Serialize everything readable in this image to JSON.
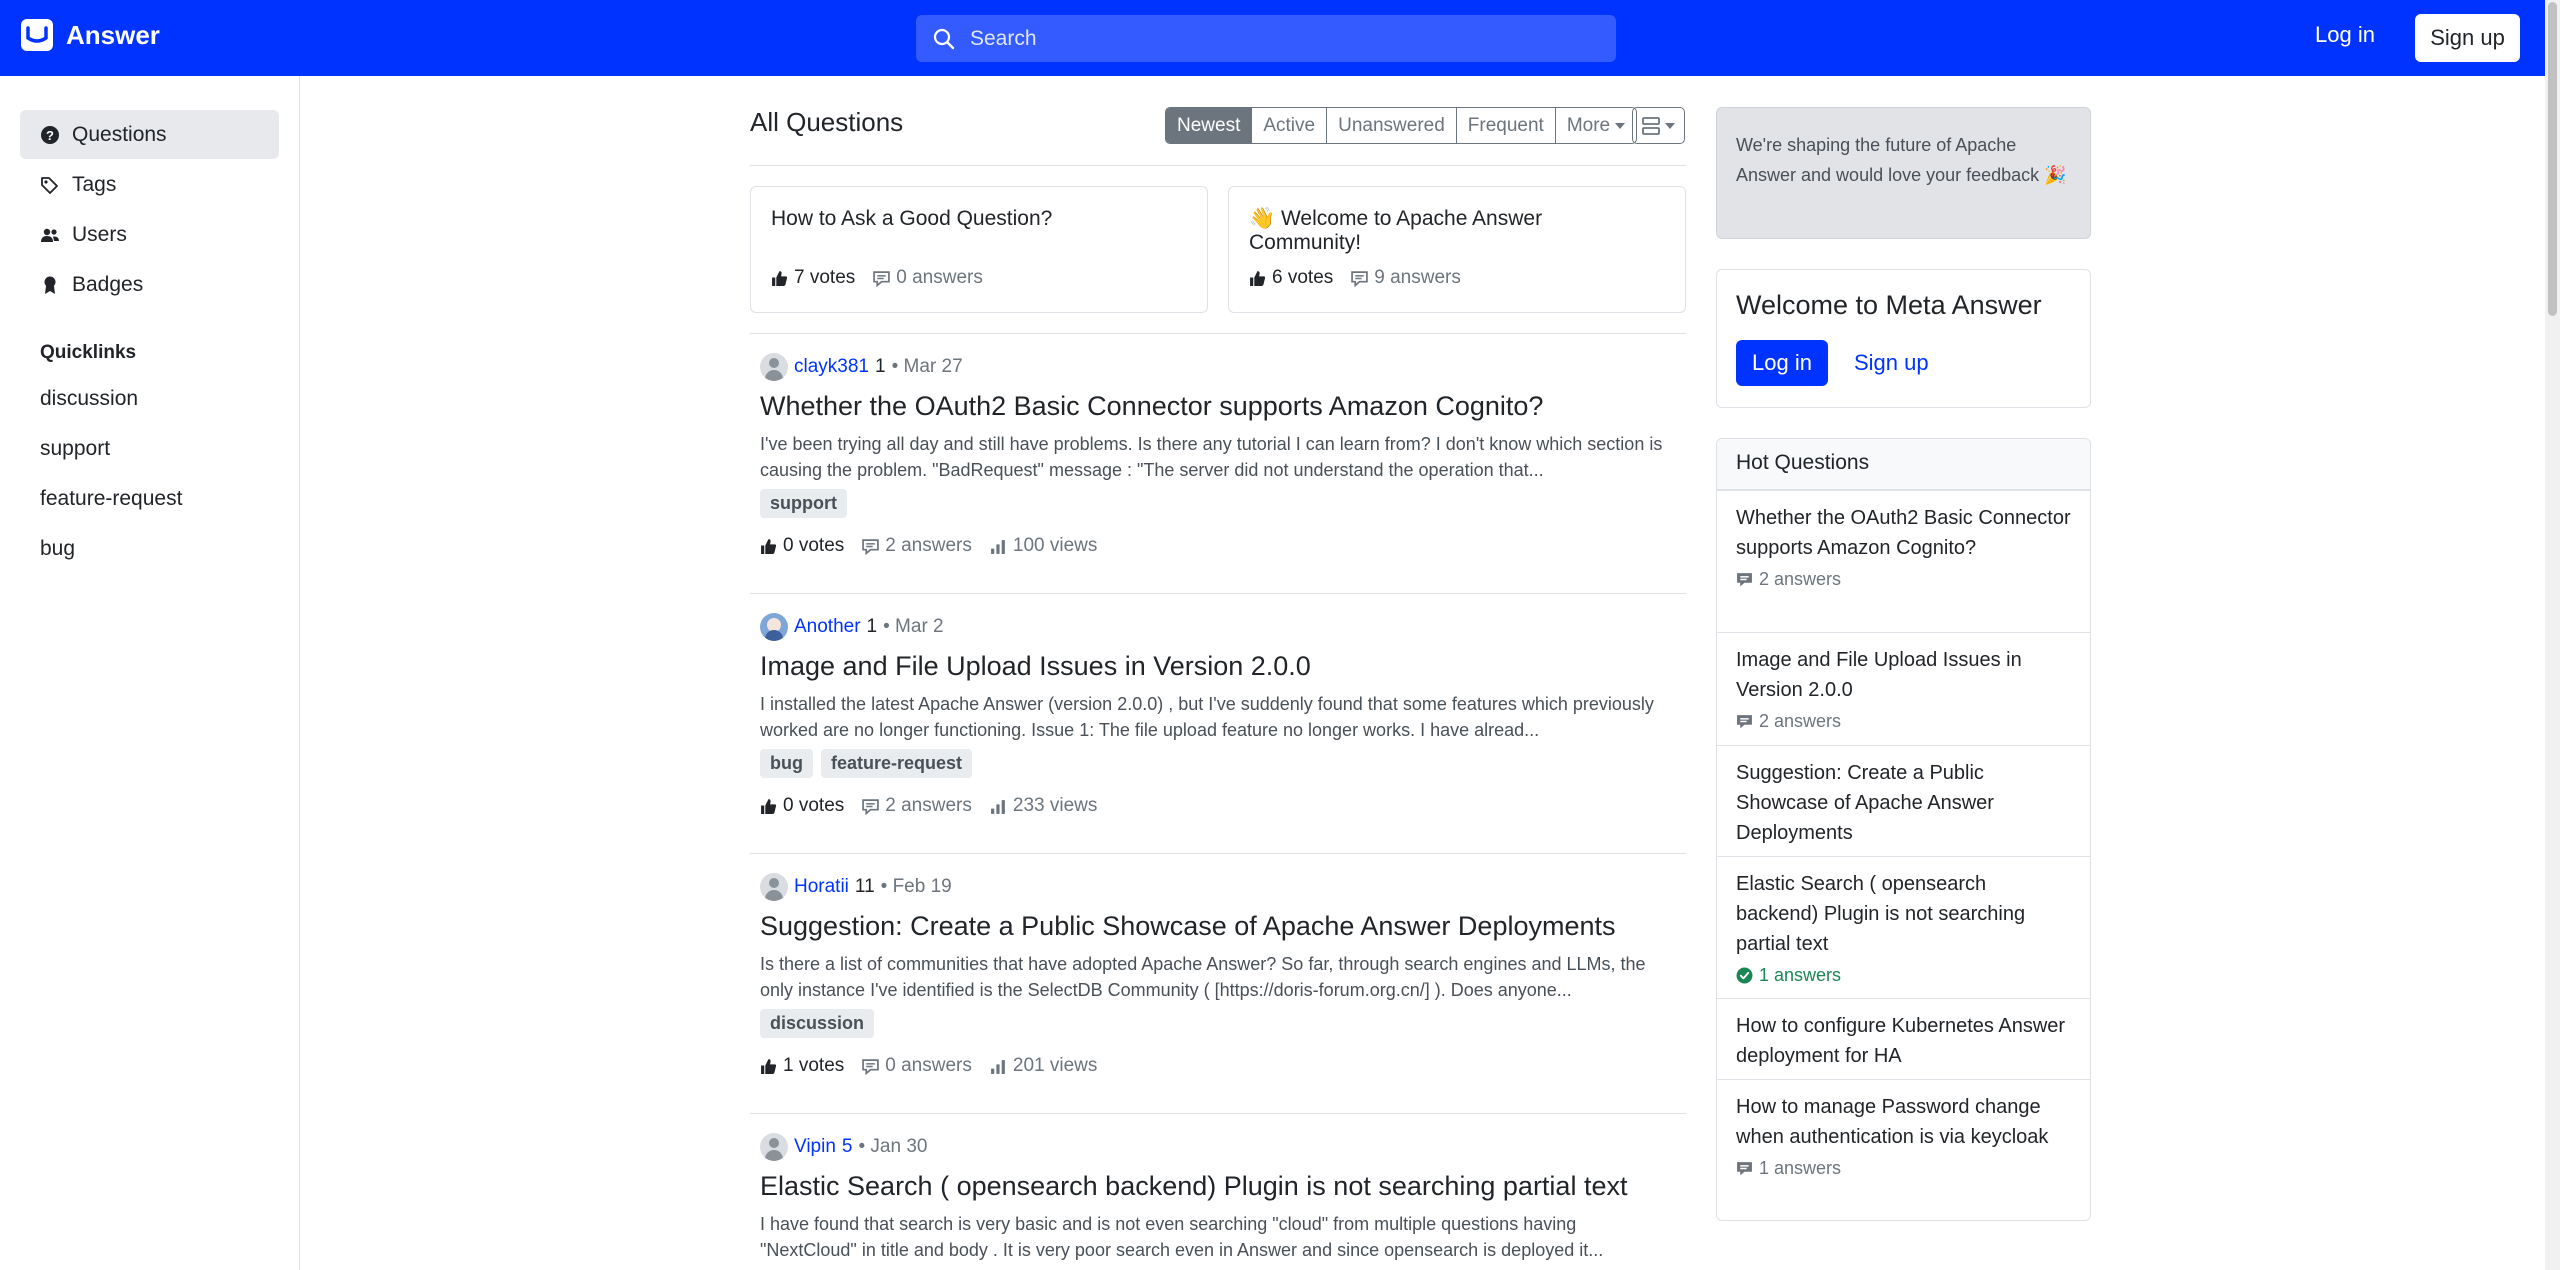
{
  "header": {
    "brand": "Answer",
    "search_placeholder": "Search",
    "login": "Log in",
    "signup": "Sign up"
  },
  "sidebar": {
    "items": [
      {
        "label": "Questions",
        "icon": "question-circle-icon",
        "active": true
      },
      {
        "label": "Tags",
        "icon": "tags-icon"
      },
      {
        "label": "Users",
        "icon": "people-icon"
      },
      {
        "label": "Badges",
        "icon": "award-icon"
      }
    ],
    "quicklinks_title": "Quicklinks",
    "quicklinks": [
      "discussion",
      "support",
      "feature-request",
      "bug"
    ]
  },
  "main": {
    "title": "All Questions",
    "sort_tabs": [
      "Newest",
      "Active",
      "Unanswered",
      "Frequent",
      "More"
    ],
    "active_sort": "Newest",
    "pinned": [
      {
        "title": "How to Ask a Good Question?",
        "votes": "7 votes",
        "answers": "0 answers"
      },
      {
        "title": "👋 Welcome to Apache Answer Community!",
        "votes": "6 votes",
        "answers": "9 answers"
      }
    ],
    "questions": [
      {
        "author": "clayk381",
        "reputation": "1",
        "date": "• Mar 27",
        "title": "Whether the OAuth2 Basic Connector supports Amazon Cognito?",
        "excerpt": "I've been trying all day and still have problems. Is there any tutorial I can learn from? I don't know which section is causing the problem. \"BadRequest\" message : \"The server did not understand the operation that...",
        "tags": [
          "support"
        ],
        "votes": "0 votes",
        "answers": "2 answers",
        "views": "100 views"
      },
      {
        "author": "Another",
        "reputation": "1",
        "date": "• Mar 2",
        "title": "Image and File Upload Issues in Version 2.0.0",
        "excerpt": "I installed the latest Apache Answer (version 2.0.0) , but I've suddenly found that some features which previously worked are no longer functioning. Issue 1: The file upload feature no longer works. I have alread...",
        "tags": [
          "bug",
          "feature-request"
        ],
        "votes": "0 votes",
        "answers": "2 answers",
        "views": "233 views"
      },
      {
        "author": "Horatii",
        "reputation": "11",
        "date": "• Feb 19",
        "title": "Suggestion: Create a Public Showcase of Apache Answer Deployments",
        "excerpt": "Is there a list of communities that have adopted Apache Answer? So far, through search engines and LLMs, the only instance I've identified is the SelectDB Community ( [https://doris-forum.org.cn/] ). Does anyone...",
        "tags": [
          "discussion"
        ],
        "votes": "1 votes",
        "answers": "0 answers",
        "views": "201 views"
      },
      {
        "author": "Vipin",
        "reputation": "5",
        "date": "• Jan 30",
        "title": "Elastic Search ( opensearch backend) Plugin is not searching partial text",
        "excerpt": "I have found that search is very basic and is not even searching \"cloud\" from multiple questions having \"NextCloud\" in title and body . It is very poor search even in Answer and since opensearch is deployed it..."
      }
    ]
  },
  "right": {
    "feedback": "We're shaping the future of Apache Answer and would love your feedback 🎉",
    "welcome_title": "Welcome to Meta Answer",
    "welcome_login": "Log in",
    "welcome_signup": "Sign up",
    "hot_title": "Hot Questions",
    "hot": [
      {
        "title": "Whether the OAuth2 Basic Connector supports Amazon Cognito?",
        "answers": "2 answers",
        "accepted": false
      },
      {
        "title": "Image and File Upload Issues in Version 2.0.0",
        "answers": "2 answers",
        "accepted": false
      },
      {
        "title": "Suggestion: Create a Public Showcase of Apache Answer Deployments",
        "answers": "",
        "accepted": false
      },
      {
        "title": "Elastic Search ( opensearch backend) Plugin is not searching partial text",
        "answers": "1 answers",
        "accepted": true
      },
      {
        "title": "How to configure Kubernetes Answer deployment for HA",
        "answers": "",
        "accepted": false
      },
      {
        "title": "How to manage Password change when authentication is via keycloak",
        "answers": "1 answers",
        "accepted": false
      }
    ]
  },
  "colors": {
    "brand": "#0033ff",
    "accepted": "#198754",
    "muted": "#6c757d"
  }
}
